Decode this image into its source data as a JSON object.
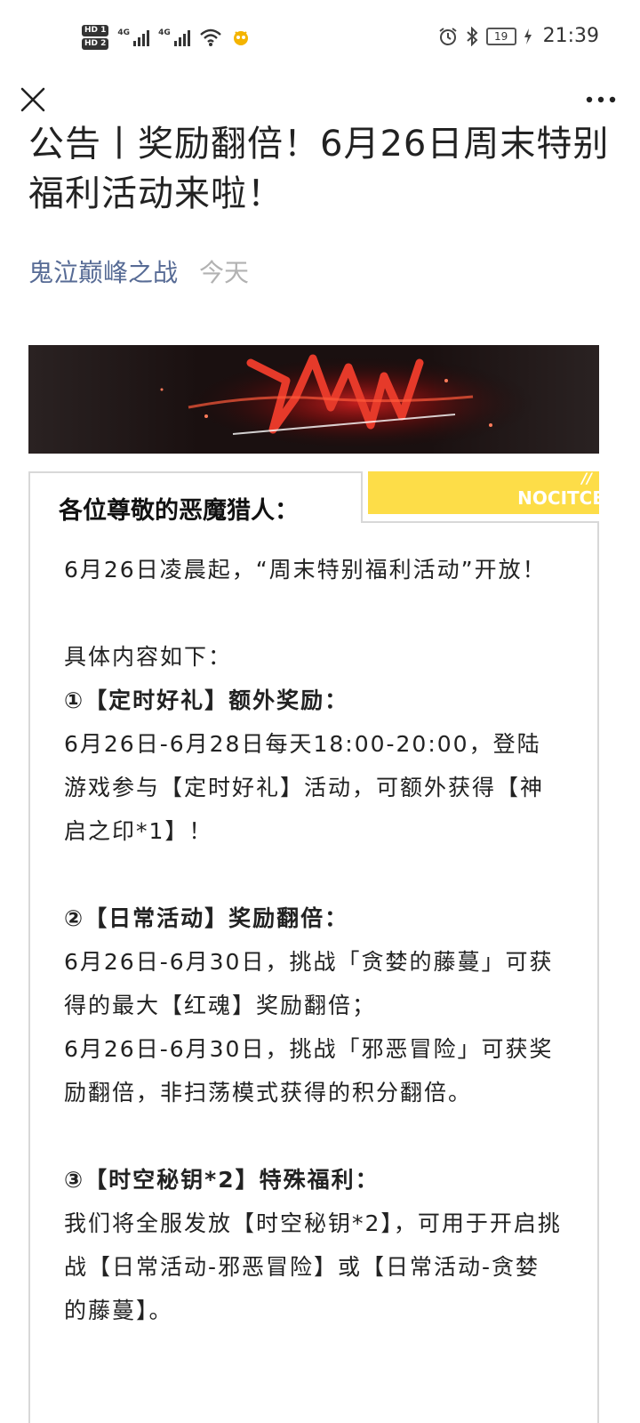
{
  "status_bar": {
    "hd1": "HD 1",
    "hd2": "HD 2",
    "net1": "4G",
    "net2": "4G",
    "battery": "19",
    "time": "21:39"
  },
  "nav": {
    "close_icon": "close-icon",
    "more_icon": "more-dots-icon"
  },
  "article": {
    "title": "公告丨奖励翻倍！6月26日周末特别福利活动来啦！",
    "account": "鬼泣巅峰之战",
    "date": "今天"
  },
  "content": {
    "greeting": "各位尊敬的恶魔猎人：",
    "tag_text": "NOCITCE",
    "intro": "6月26日凌晨起，“周末特别福利活动”开放！",
    "lead": "具体内容如下：",
    "section1_title": "①【定时好礼】额外奖励：",
    "section1_body": "6月26日-6月28日每天18:00-20:00，登陆游戏参与【定时好礼】活动，可额外获得【神启之印*1】！",
    "section2_title": "②【日常活动】奖励翻倍：",
    "section2_body1": "6月26日-6月30日，挑战「贪婪的藤蔓」可获得的最大【红魂】奖励翻倍；",
    "section2_body2": "6月26日-6月30日，挑战「邪恶冒险」可获奖励翻倍，非扫荡模式获得的积分翻倍。",
    "section3_title": "③【时空秘钥*2】特殊福利：",
    "section3_body": "我们将全服发放【时空秘钥*2】，可用于开启挑战【日常活动-邪恶冒险】或【日常活动-贪婪的藤蔓】。"
  },
  "colors": {
    "account_link": "#576b95",
    "date_gray": "#b2b2b2",
    "accent_yellow": "#fddd48",
    "border_gray": "#d8d8d8"
  }
}
